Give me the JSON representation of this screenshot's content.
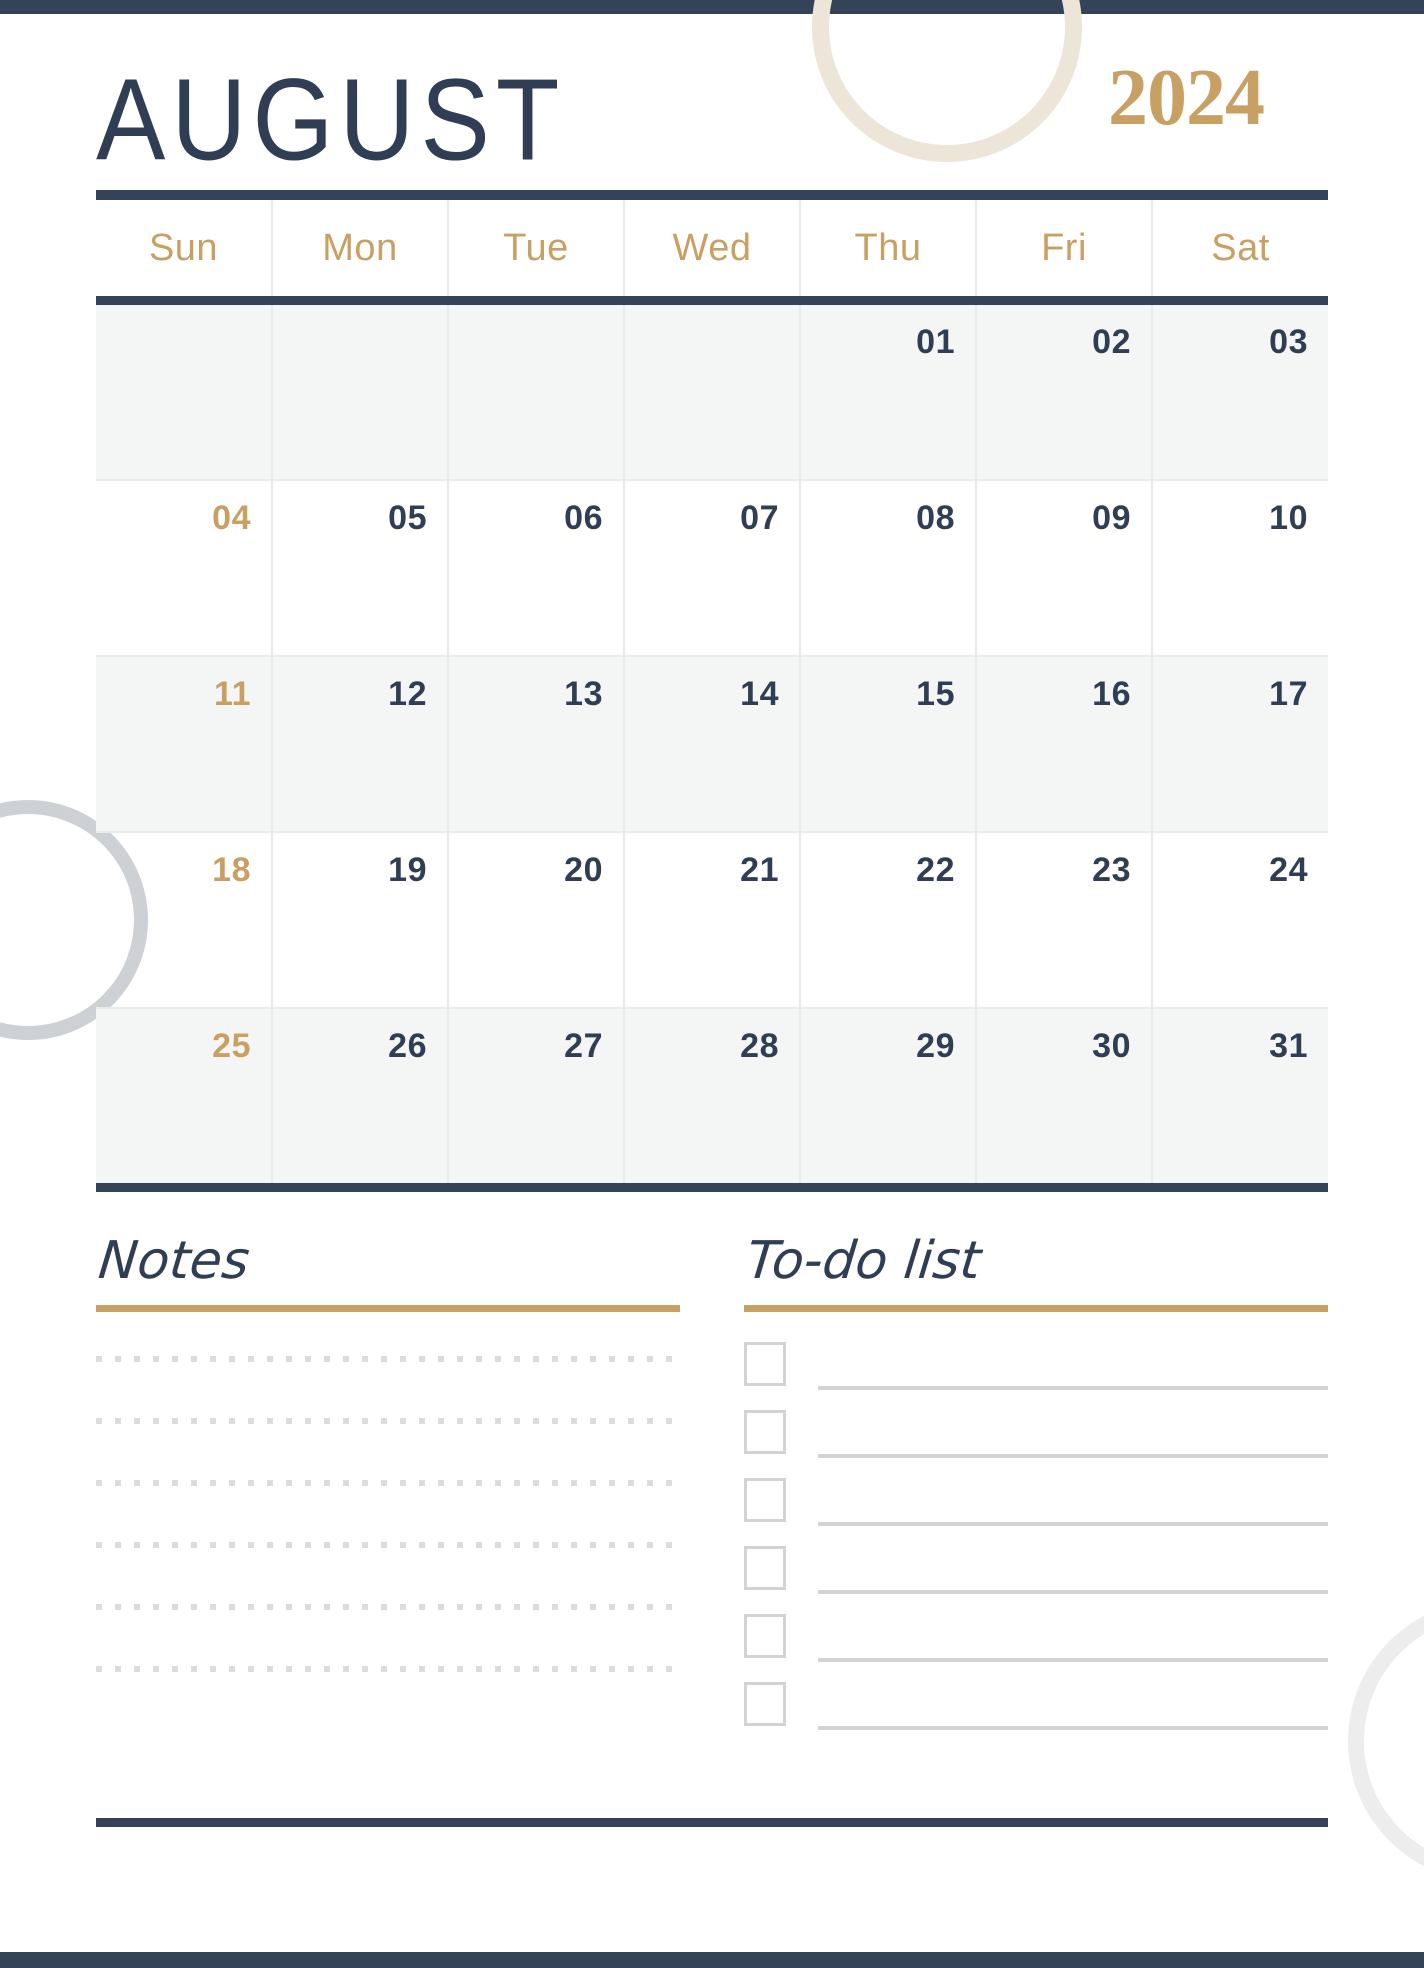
{
  "page": {
    "background": "#ffffff",
    "accent_navy": "#354359",
    "accent_gold": "#c8a063",
    "accent_cream": "#ece5d8",
    "grid_line": "#e7eceb",
    "shaded_row": "#f4f6f5"
  },
  "header": {
    "month": "AUGUST",
    "year": "2024"
  },
  "calendar": {
    "weekdays": [
      "Sun",
      "Mon",
      "Tue",
      "Wed",
      "Thu",
      "Fri",
      "Sat"
    ],
    "weeks": [
      [
        "",
        "",
        "",
        "",
        "01",
        "02",
        "03"
      ],
      [
        "04",
        "05",
        "06",
        "07",
        "08",
        "09",
        "10"
      ],
      [
        "11",
        "12",
        "13",
        "14",
        "15",
        "16",
        "17"
      ],
      [
        "18",
        "19",
        "20",
        "21",
        "22",
        "23",
        "24"
      ],
      [
        "25",
        "26",
        "27",
        "28",
        "29",
        "30",
        "31"
      ]
    ]
  },
  "notes": {
    "title": "Notes",
    "line_count": 6
  },
  "todo": {
    "title": "To-do list",
    "item_count": 6
  }
}
